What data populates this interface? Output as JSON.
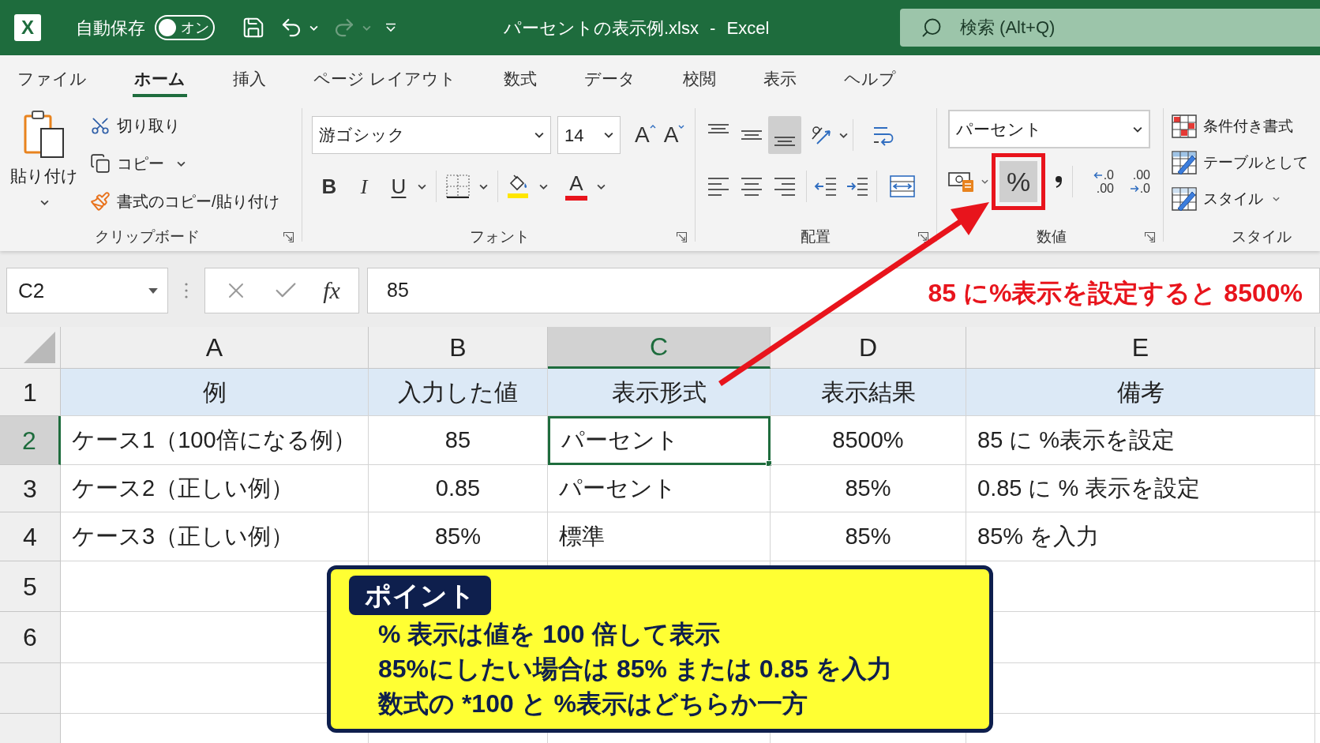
{
  "title_bar": {
    "logo_letter": "X",
    "autosave": {
      "label": "自動保存",
      "toggle_text": "オン"
    },
    "quick_access": [
      {
        "kind": "save",
        "disabled": false,
        "menu": false
      },
      {
        "kind": "undo",
        "disabled": false,
        "menu": true
      },
      {
        "kind": "redo",
        "disabled": true,
        "menu": true
      },
      {
        "kind": "customize",
        "disabled": false,
        "menu": false
      }
    ],
    "document_title": "パーセントの表示例.xlsx - Excel",
    "search": {
      "placeholder": "検索 (Alt+Q)"
    }
  },
  "ribbon_tabs": [
    {
      "label": "ファイル",
      "selected": false
    },
    {
      "label": "ホーム",
      "selected": true
    },
    {
      "label": "挿入",
      "selected": false
    },
    {
      "label": "ページ レイアウト",
      "selected": false
    },
    {
      "label": "数式",
      "selected": false
    },
    {
      "label": "データ",
      "selected": false
    },
    {
      "label": "校閲",
      "selected": false
    },
    {
      "label": "表示",
      "selected": false
    },
    {
      "label": "ヘルプ",
      "selected": false
    }
  ],
  "ribbon": {
    "clipboard": {
      "paste": "貼り付け",
      "actions": [
        {
          "kind": "cut",
          "label": "切り取り",
          "menu": false
        },
        {
          "kind": "copy",
          "label": "コピー",
          "menu": true
        },
        {
          "kind": "format_painter",
          "label": "書式のコピー/貼り付け",
          "menu": false
        }
      ],
      "group_label": "クリップボード"
    },
    "font": {
      "font_name": "游ゴシック",
      "font_size": "14",
      "size_buttons": [
        {
          "kind": "grow",
          "label": "A"
        },
        {
          "kind": "shrink",
          "label": "A"
        }
      ],
      "style_buttons": [
        {
          "kind": "bold",
          "label": "B",
          "menu": false
        },
        {
          "kind": "italic",
          "label": "I",
          "menu": false
        },
        {
          "kind": "underline",
          "label": "U",
          "menu": true
        }
      ],
      "font_color_label": "A",
      "group_label": "フォント"
    },
    "alignment": {
      "vertical": [
        {
          "kind": "top",
          "selected": false
        },
        {
          "kind": "middle",
          "selected": false
        },
        {
          "kind": "bottom",
          "selected": true
        }
      ],
      "horizontal": [
        {
          "kind": "left",
          "selected": false
        },
        {
          "kind": "center",
          "selected": false
        },
        {
          "kind": "right",
          "selected": false
        }
      ],
      "group_label": "配置"
    },
    "number": {
      "format": "パーセント",
      "percent": {
        "label": "%",
        "selected": true,
        "highlighted": true
      },
      "decimal_buttons": [
        {
          "kind": "increase",
          "top": ".0",
          "bottom": ".00"
        },
        {
          "kind": "decrease",
          "top": ".00",
          "bottom": ".0"
        }
      ],
      "group_label": "数値"
    },
    "styles": {
      "items": [
        {
          "kind": "conditional",
          "label": "条件付き書式",
          "menu": false
        },
        {
          "kind": "table",
          "label": "テーブルとして",
          "menu": false
        },
        {
          "kind": "cell_styles",
          "label": "スタイル",
          "menu": true
        }
      ],
      "group_label": "スタイル"
    }
  },
  "formula_bar": {
    "name_box": "C2",
    "function_label": "fx",
    "formula": "85"
  },
  "annotation": {
    "text": "85 に%表示を設定すると 8500%"
  },
  "sheet": {
    "columns": [
      {
        "label": "A",
        "selected": false
      },
      {
        "label": "B",
        "selected": false
      },
      {
        "label": "C",
        "selected": true
      },
      {
        "label": "D",
        "selected": false
      },
      {
        "label": "E",
        "selected": false
      }
    ],
    "row_headers": [
      {
        "label": "1",
        "selected": false
      },
      {
        "label": "2",
        "selected": true
      },
      {
        "label": "3",
        "selected": false
      },
      {
        "label": "4",
        "selected": false
      },
      {
        "label": "5",
        "selected": false
      },
      {
        "label": "6",
        "selected": false
      }
    ],
    "header_row": [
      "例",
      "入力した値",
      "表示形式",
      "表示結果",
      "備考"
    ],
    "rows": [
      {
        "cells": [
          {
            "text": "ケース1（100倍になる例）",
            "selected": false
          },
          {
            "text": "85",
            "selected": false
          },
          {
            "text": "パーセント",
            "selected": true
          },
          {
            "text": "8500%",
            "selected": false
          },
          {
            "text": "85 に %表示を設定",
            "selected": false
          }
        ]
      },
      {
        "cells": [
          {
            "text": "ケース2（正しい例）",
            "selected": false
          },
          {
            "text": "0.85",
            "selected": false
          },
          {
            "text": "パーセント",
            "selected": false
          },
          {
            "text": "85%",
            "selected": false
          },
          {
            "text": "0.85 に % 表示を設定",
            "selected": false
          }
        ]
      },
      {
        "cells": [
          {
            "text": "ケース3（正しい例）",
            "selected": false
          },
          {
            "text": "85%",
            "selected": false
          },
          {
            "text": "標準",
            "selected": false
          },
          {
            "text": "85%",
            "selected": false
          },
          {
            "text": "85% を入力",
            "selected": false
          }
        ]
      }
    ]
  },
  "point_box": {
    "badge": "ポイント",
    "lines": [
      "% 表示は値を 100 倍して表示",
      "85%にしたい場合は 85% または 0.85 を入力",
      "数式の *100 と %表示はどちらか一方"
    ]
  }
}
